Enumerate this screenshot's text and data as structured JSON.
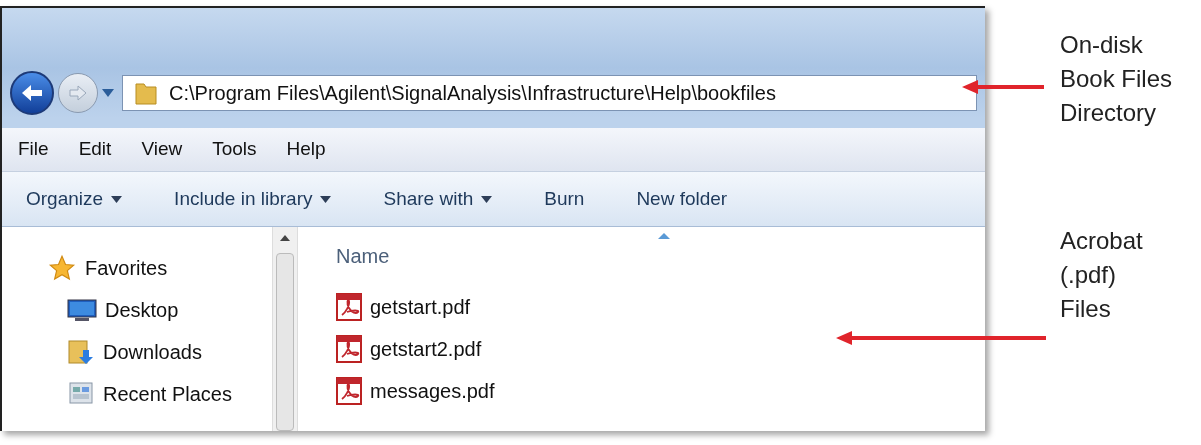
{
  "address_bar": {
    "path": "C:\\Program Files\\Agilent\\SignalAnalysis\\Infrastructure\\Help\\bookfiles"
  },
  "menu": [
    "File",
    "Edit",
    "View",
    "Tools",
    "Help"
  ],
  "toolbar": [
    {
      "label": "Organize",
      "dropdown": true
    },
    {
      "label": "Include in library",
      "dropdown": true
    },
    {
      "label": "Share with",
      "dropdown": true
    },
    {
      "label": "Burn",
      "dropdown": false
    },
    {
      "label": "New folder",
      "dropdown": false
    }
  ],
  "sidebar": {
    "items": [
      {
        "label": "Favorites",
        "kind": "star"
      },
      {
        "label": "Desktop",
        "kind": "desktop"
      },
      {
        "label": "Downloads",
        "kind": "downloads"
      },
      {
        "label": "Recent Places",
        "kind": "recent"
      }
    ]
  },
  "file_list": {
    "column": "Name",
    "files": [
      "getstart.pdf",
      "getstart2.pdf",
      "messages.pdf"
    ]
  },
  "annotations": [
    {
      "text": "On-disk\nBook Files\nDirectory"
    },
    {
      "text": "Acrobat\n(.pdf)\nFiles"
    }
  ]
}
